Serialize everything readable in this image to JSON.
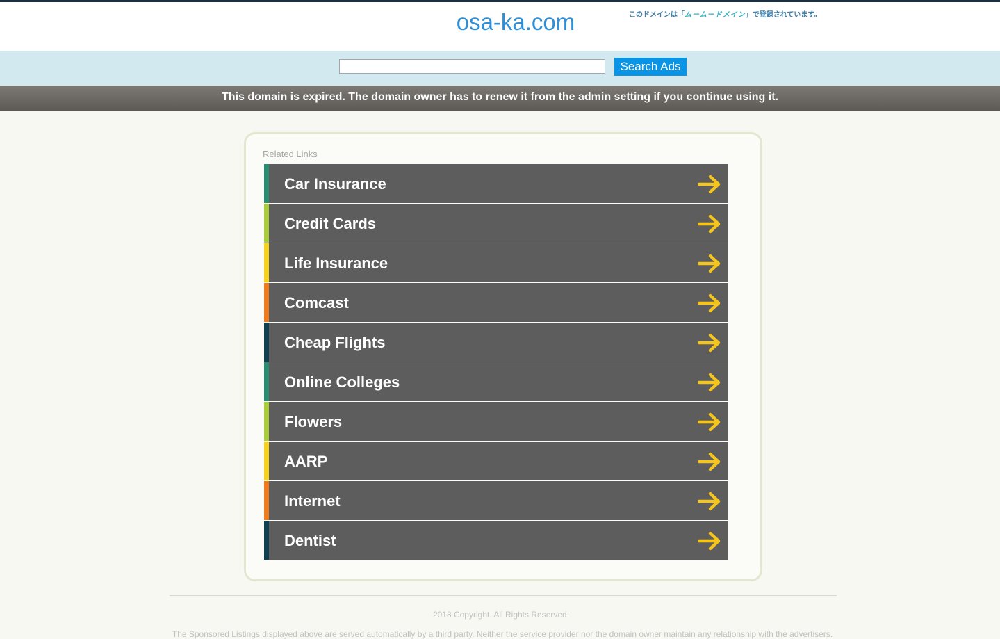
{
  "header": {
    "site_title": "osa-ka.com",
    "jp_notice_prefix": "このドメインは「",
    "jp_notice_handle": "ムームードメイン",
    "jp_notice_suffix": "」で登録されています。"
  },
  "search": {
    "placeholder": "",
    "value": "",
    "button_label": "Search Ads"
  },
  "notice": {
    "expired_text": "This domain is expired. The domain owner has to renew it from the admin setting if you continue using it."
  },
  "related": {
    "label": "Related Links",
    "items": [
      {
        "label": "Car Insurance",
        "accent": "#2a8c70"
      },
      {
        "label": "Credit Cards",
        "accent": "#a9cc3a"
      },
      {
        "label": "Life Insurance",
        "accent": "#f6d21f"
      },
      {
        "label": "Comcast",
        "accent": "#f07b1d"
      },
      {
        "label": "Cheap Flights",
        "accent": "#0f4150"
      },
      {
        "label": "Online Colleges",
        "accent": "#2a8c70"
      },
      {
        "label": "Flowers",
        "accent": "#a9cc3a"
      },
      {
        "label": "AARP",
        "accent": "#f6d21f"
      },
      {
        "label": "Internet",
        "accent": "#f07b1d"
      },
      {
        "label": "Dentist",
        "accent": "#0f4150"
      }
    ],
    "arrow_icon": "arrow-right-icon",
    "arrow_color": "#f5c51f"
  },
  "footer": {
    "copyright": "2018 Copyright. All Rights Reserved.",
    "disclaimer": "The Sponsored Listings displayed above are served automatically by a third party. Neither the service provider nor the domain owner maintain any relationship with the advertisers."
  },
  "colors": {
    "title_blue": "#2f8fd6",
    "search_bg": "#d3e9f0",
    "button_blue": "#0a94e6",
    "link_bg": "#5d5d5d"
  }
}
